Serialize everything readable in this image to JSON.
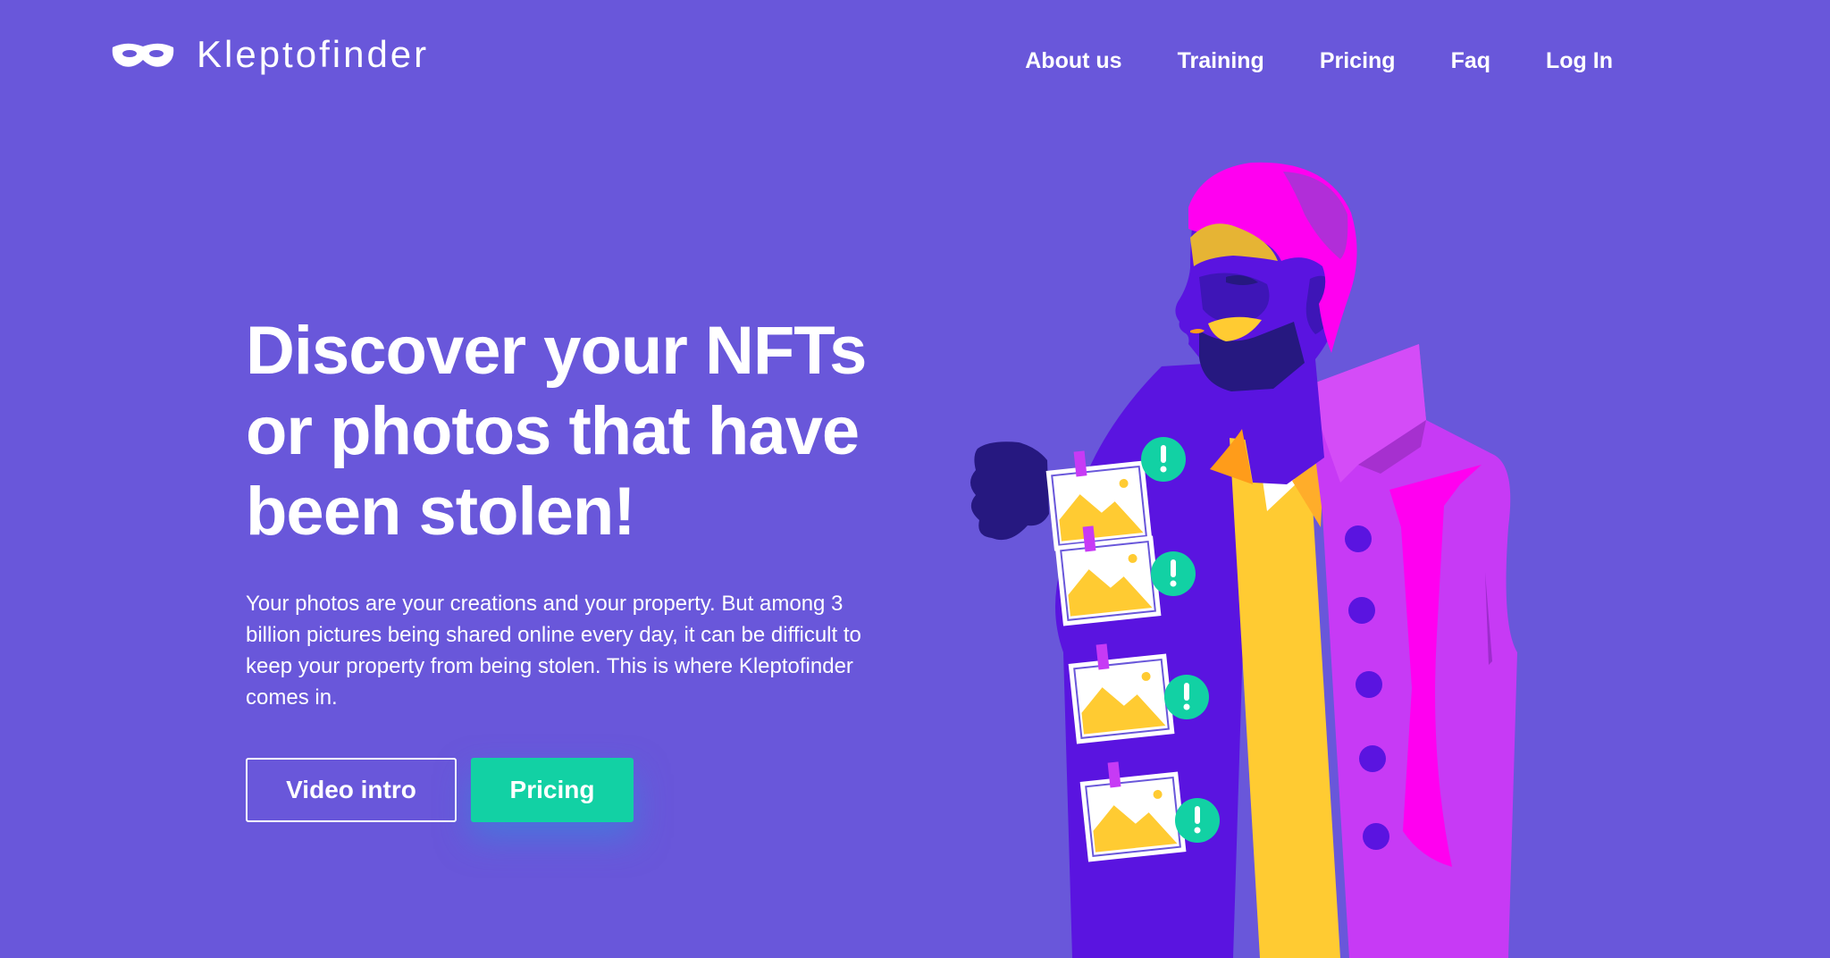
{
  "header": {
    "brand": "Kleptofinder",
    "logo_icon": "mask-icon",
    "nav": [
      {
        "label": "About us"
      },
      {
        "label": "Training"
      },
      {
        "label": "Pricing"
      },
      {
        "label": "Faq"
      },
      {
        "label": "Log In"
      }
    ]
  },
  "hero": {
    "title_lines": [
      "Discover your NFTs",
      "or photos that have",
      "been stolen!"
    ],
    "description": "Your photos are your creations and your property. But among 3 billion pictures being shared online every day, it can be difficult to keep your property from being stolen. This is where Kleptofinder comes in.",
    "buttons": {
      "video_intro": "Video intro",
      "pricing": "Pricing"
    }
  },
  "colors": {
    "background": "#6957da",
    "accent": "#12d1a4",
    "text": "#ffffff",
    "coat": "#c73af5",
    "shirt": "#ffcb32",
    "jacket_inner": "#5a14e0"
  },
  "illustration": {
    "subject": "man-in-trench-coat-holding-stolen-photos",
    "alert_icon": "exclamation-icon",
    "photo_icon": "image-icon"
  }
}
